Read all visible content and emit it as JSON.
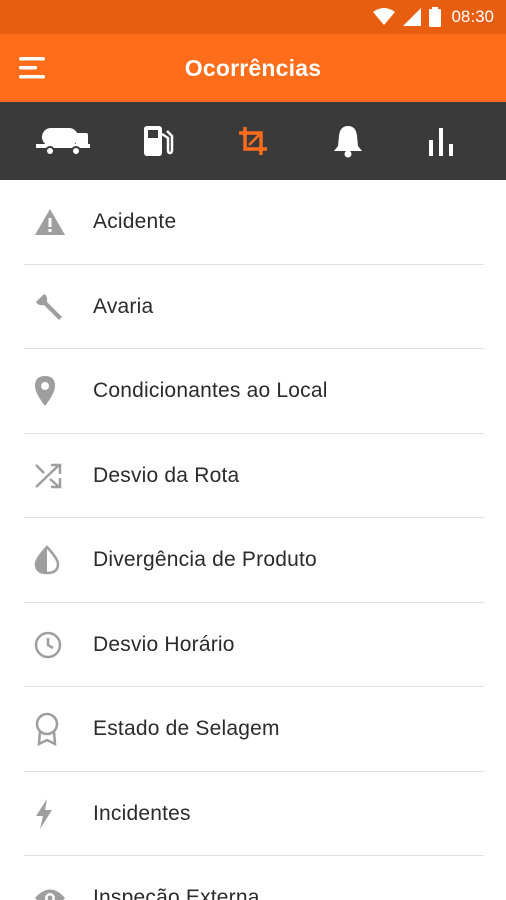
{
  "status_bar": {
    "time": "08:30",
    "icons": [
      "wifi-icon",
      "signal-icon",
      "battery-icon"
    ]
  },
  "app_bar": {
    "title": "Ocorrências",
    "menu_icon": "hamburger-menu-icon"
  },
  "tabs": [
    {
      "icon": "truck-icon",
      "active": false
    },
    {
      "icon": "fuel-pump-icon",
      "active": false
    },
    {
      "icon": "crop-icon",
      "active": true
    },
    {
      "icon": "bell-icon",
      "active": false
    },
    {
      "icon": "bar-chart-icon",
      "active": false
    }
  ],
  "colors": {
    "status_bar": "#e85e10",
    "app_bar": "#ff6d1a",
    "tab_bar": "#3a3a3a",
    "tab_icon": "#ffffff",
    "tab_icon_active": "#ff6d1a",
    "list_icon": "#9e9e9e",
    "list_text": "#2b2b2b",
    "divider": "#e2e2e2"
  },
  "items": [
    {
      "label": "Acidente",
      "icon": "warning-icon"
    },
    {
      "label": "Avaria",
      "icon": "wrench-icon"
    },
    {
      "label": "Condicionantes ao Local",
      "icon": "location-pin-icon"
    },
    {
      "label": "Desvio da Rota",
      "icon": "shuffle-icon"
    },
    {
      "label": "Divergência de Produto",
      "icon": "contrast-icon"
    },
    {
      "label": "Desvio Horário",
      "icon": "clock-icon"
    },
    {
      "label": "Estado de Selagem",
      "icon": "seal-badge-icon"
    },
    {
      "label": "Incidentes",
      "icon": "lightning-icon"
    },
    {
      "label": "Inspeção Externa",
      "icon": "eye-icon"
    }
  ]
}
